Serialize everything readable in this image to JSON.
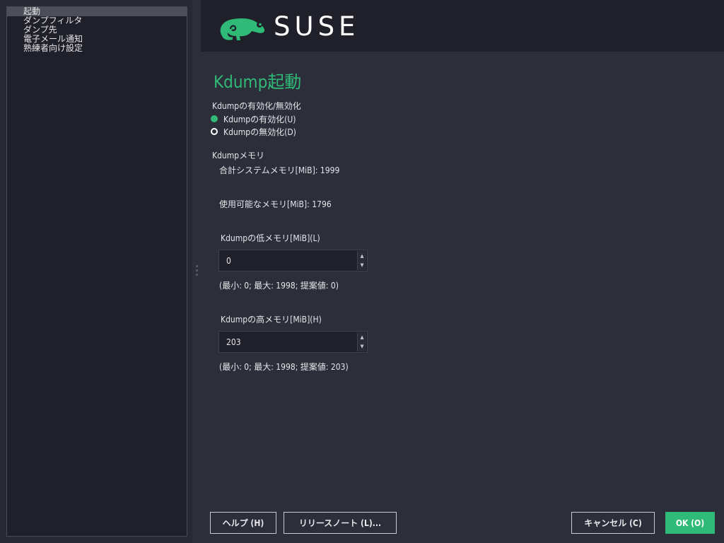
{
  "sidebar": {
    "items": [
      {
        "label": "起動",
        "selected": true
      },
      {
        "label": "ダンプフィルタ",
        "selected": false
      },
      {
        "label": "ダンプ先",
        "selected": false
      },
      {
        "label": "電子メール通知",
        "selected": false
      },
      {
        "label": "熟練者向け設定",
        "selected": false
      }
    ]
  },
  "header": {
    "brand": "SUSE",
    "logo_icon": "suse-chameleon-logo",
    "brand_color": "#30ba78"
  },
  "page": {
    "title": "Kdump起動"
  },
  "enable_group": {
    "label": "Kdumpの有効化/無効化",
    "options": [
      {
        "label": "Kdumpの有効化(U)",
        "selected": true
      },
      {
        "label": "Kdumpの無効化(D)",
        "selected": false
      }
    ]
  },
  "memory": {
    "section_label": "Kdumpメモリ",
    "total_label": "合計システムメモリ[MiB]:",
    "total_value": "1999",
    "available_label": "使用可能なメモリ[MiB]:",
    "available_value": "1796",
    "low": {
      "label": "Kdumpの低メモリ[MiB](L)",
      "value": "0",
      "range_prefix": "(最小: 0; 最大:",
      "max": "1998",
      "range_suffix": "; 提案値: 0)"
    },
    "high": {
      "label": "Kdumpの高メモリ[MiB](H)",
      "value": "203",
      "range_prefix": "(最小: 0; 最大:",
      "max": "1998",
      "range_suffix": "; 提案値: 203)"
    }
  },
  "buttons": {
    "help": "ヘルプ (H)",
    "release_notes": "リリースノート (L)...",
    "cancel": "キャンセル (C)",
    "ok": "OK (O)"
  }
}
